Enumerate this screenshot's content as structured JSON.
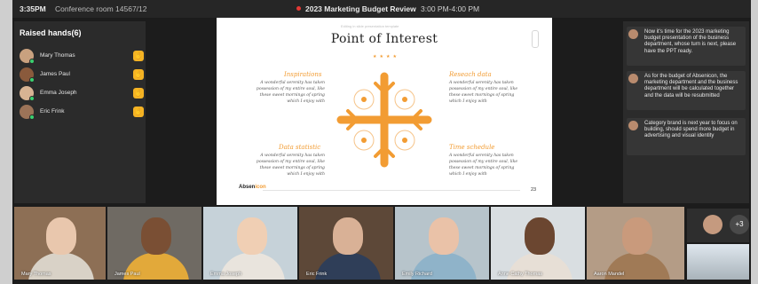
{
  "topbar": {
    "time": "3:35PM",
    "room": "Conference room 14567/12",
    "meeting_title": "2023 Marketing Budget Review",
    "time_range": "3:00 PM-4:00 PM"
  },
  "raised_hands": {
    "header": "Raised hands(6)",
    "people": [
      {
        "name": "Mary Thomas",
        "avatar_color": "#c9a17f"
      },
      {
        "name": "James Paul",
        "avatar_color": "#8a5a3c"
      },
      {
        "name": "Emma Joseph",
        "avatar_color": "#d8b393"
      },
      {
        "name": "Eric Frink",
        "avatar_color": "#9c7358"
      }
    ]
  },
  "slide": {
    "top_text": "Editing in slide presentation template",
    "title": "Point of Interest",
    "sections": [
      {
        "heading": "Inspirations",
        "body": "A wonderful serenity has taken possession of my entire soul, like these sweet mornings of spring which I enjoy with"
      },
      {
        "heading": "Reseach data",
        "body": "A wonderful serenity has taken possession of my entire soul, like these sweet mornings of spring which I enjoy with"
      },
      {
        "heading": "Data statistic",
        "body": "A wonderful serenity has taken possession of my entire soul, like these sweet mornings of spring which I enjoy with"
      },
      {
        "heading": "Time schedule",
        "body": "A wonderful serenity has taken possession of my entire soul, like these sweet mornings of spring which I enjoy with"
      }
    ],
    "logo_a": "Absen",
    "logo_b": "icon",
    "page_number": "23",
    "accent": "#f29c33"
  },
  "chat": {
    "messages": [
      {
        "text": "Now it's time for the 2023 marketing budget presentation of the business department, whose turn is next, please have the PPT ready."
      },
      {
        "text": "As for the budget of Absenicon, the marketing department and the business department will be calculated together and the data will be resubmitted"
      },
      {
        "text": "Category brand is next year to focus on building, should spend more budget in advertising and visual identity"
      }
    ]
  },
  "participants": [
    {
      "name": "Mary Thomas",
      "bg": "#8d6f55",
      "skin": "#e9c7ad",
      "shirt": "#d9d2c7"
    },
    {
      "name": "James Paul",
      "bg": "#6f6a63",
      "skin": "#7a4f34",
      "shirt": "#e2a93a"
    },
    {
      "name": "Emma Joseph",
      "bg": "#c6d2d9",
      "skin": "#f0cfb4",
      "shirt": "#e9e4dd"
    },
    {
      "name": "Eric Frink",
      "bg": "#5d4838",
      "skin": "#d9b196",
      "shirt": "#2f3e58"
    },
    {
      "name": "Emily Richard",
      "bg": "#b7c4cb",
      "skin": "#eac2a8",
      "shirt": "#8fb3c9"
    },
    {
      "name": "Anne Cathy Thomas",
      "bg": "#d9dee1",
      "skin": "#6b4630",
      "shirt": "#e7dfd6"
    },
    {
      "name": "Aaron Mandel",
      "bg": "#b49c86",
      "skin": "#c99a7c",
      "shirt": "#a07a56"
    }
  ],
  "extra_count": "+3"
}
